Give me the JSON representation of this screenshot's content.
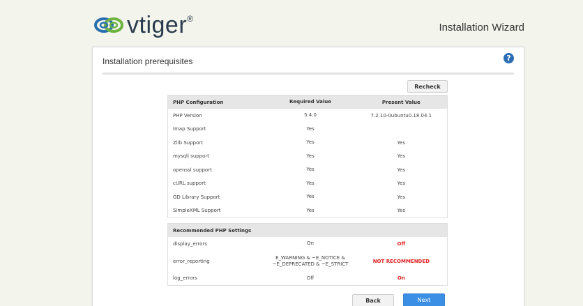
{
  "header": {
    "logo_text": "vtiger",
    "logo_mark": "®",
    "wizard_title": "Installation Wizard"
  },
  "card": {
    "title": "Installation prerequisites",
    "help_icon": "help-icon",
    "recheck_label": "Recheck"
  },
  "php_config": {
    "headers": [
      "PHP Configuration",
      "Required Value",
      "Present Value"
    ],
    "rows": [
      {
        "name": "PHP Version",
        "required": "5.4.0",
        "present": "7.2.10-0ubuntu0.18.04.1"
      },
      {
        "name": "Imap Support",
        "required": "Yes",
        "present": ""
      },
      {
        "name": "Zlib Support",
        "required": "Yes",
        "present": "Yes"
      },
      {
        "name": "mysqli support",
        "required": "Yes",
        "present": "Yes"
      },
      {
        "name": "openssl support",
        "required": "Yes",
        "present": "Yes"
      },
      {
        "name": "cURL support",
        "required": "Yes",
        "present": "Yes"
      },
      {
        "name": "GD Library Support",
        "required": "Yes",
        "present": "Yes"
      },
      {
        "name": "SimpleXML Support",
        "required": "Yes",
        "present": "Yes"
      }
    ]
  },
  "recommended": {
    "header": "Recommended PHP Settings",
    "rows": [
      {
        "name": "display_errors",
        "required": "On",
        "present": "Off"
      },
      {
        "name": "error_reporting",
        "required_line1": "E_WARNING & ~E_NOTICE &",
        "required_line2": "~E_DEPRECATED & ~E_STRICT",
        "present": "NOT RECOMMENDED"
      },
      {
        "name": "log_errors",
        "required": "Off",
        "present": "On"
      }
    ]
  },
  "footer": {
    "back_label": "Back",
    "next_label": "Next"
  },
  "colors": {
    "accent": "#3b8fe5",
    "warning": "#e02020",
    "logo_green": "#6db33f",
    "logo_blue": "#2a6fb0"
  }
}
